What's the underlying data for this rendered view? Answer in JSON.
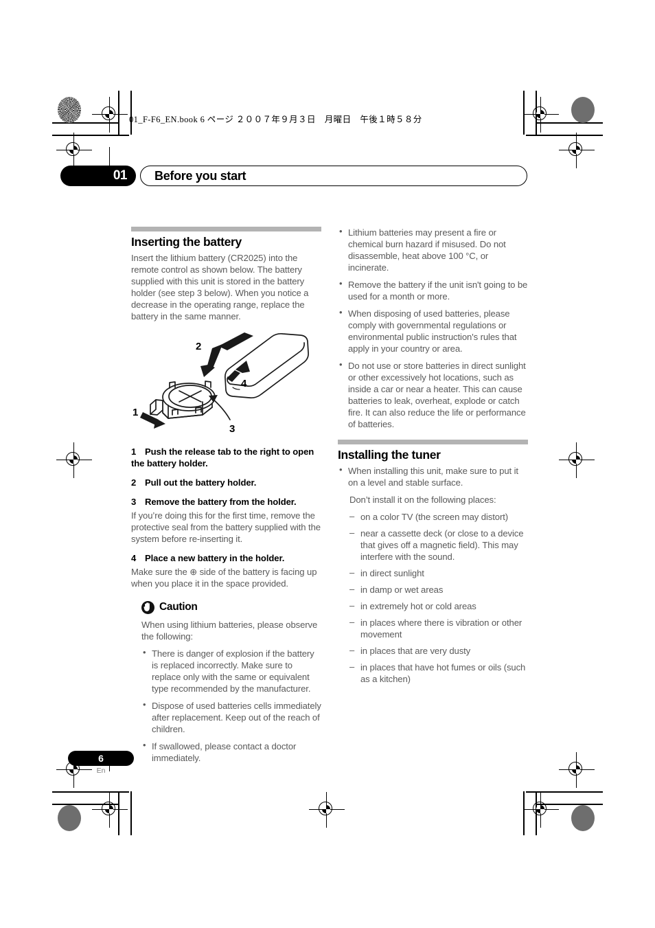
{
  "print_marks": {
    "slugline": "01_F-F6_EN.book  6 ページ  ２００７年９月３日　月曜日　午後１時５８分"
  },
  "chapter": {
    "number": "01",
    "title": "Before you start"
  },
  "left_column": {
    "section_title": "Inserting the battery",
    "intro": "Insert the lithium battery (CR2025) into the remote control as shown below. The battery supplied with this unit is stored in the battery holder (see step 3 below). When you notice a decrease in the operating range, replace the battery in the same manner.",
    "figure": {
      "name": "remote-control-battery-diagram",
      "callouts": [
        "1",
        "2",
        "3",
        "4"
      ]
    },
    "steps": [
      {
        "number": "1",
        "title": "Push the release tab to the right to open the battery holder.",
        "body": ""
      },
      {
        "number": "2",
        "title": "Pull out the battery holder.",
        "body": ""
      },
      {
        "number": "3",
        "title": "Remove the battery from the holder.",
        "body": "If you’re doing this for the first time, remove the protective seal from the battery supplied with the system before re-inserting it."
      },
      {
        "number": "4",
        "title": "Place a new battery in the holder.",
        "body": "Make sure the ⊕ side of the battery is facing up when you place it in the space provided."
      }
    ],
    "caution": {
      "icon": "caution-hand-icon",
      "title": "Caution",
      "intro": "When using lithium batteries, please observe the following:",
      "bullets": [
        "There is danger of explosion if the battery is replaced incorrectly. Make sure to replace only with the same or equivalent type recommended by the manufacturer.",
        "Dispose of used batteries cells immediately after replacement. Keep out of the reach of children.",
        "If swallowed, please contact a doctor immediately."
      ]
    }
  },
  "right_column": {
    "battery_bullets": [
      "Lithium batteries may present a fire or chemical burn hazard if misused. Do not disassemble, heat above 100 °C, or incinerate.",
      "Remove the battery if the unit isn't going to be used for a month or more.",
      "When disposing of used batteries, please comply with governmental regulations or environmental public instruction's rules that apply in your country or area.",
      "Do not use or store batteries in direct sunlight or other excessively hot locations, such as inside a car or near a heater. This can cause batteries to leak, overheat, explode or catch fire. It can also reduce the life or performance of batteries."
    ],
    "section_title": "Installing the tuner",
    "install_bullet": "When installing this unit, make sure to put it on a level and stable surface.",
    "install_note": "Don’t install it on the following places:",
    "install_places": [
      "on a color TV (the screen may distort)",
      "near a cassette deck (or close to a device that gives off a magnetic field). This may interfere with the sound.",
      "in direct sunlight",
      "in damp or wet areas",
      "in extremely hot or cold areas",
      "in places where there is vibration or other movement",
      "in places that are very dusty",
      "in places that have hot fumes or oils (such as a kitchen)"
    ]
  },
  "footer": {
    "page_number": "6",
    "language": "En"
  }
}
